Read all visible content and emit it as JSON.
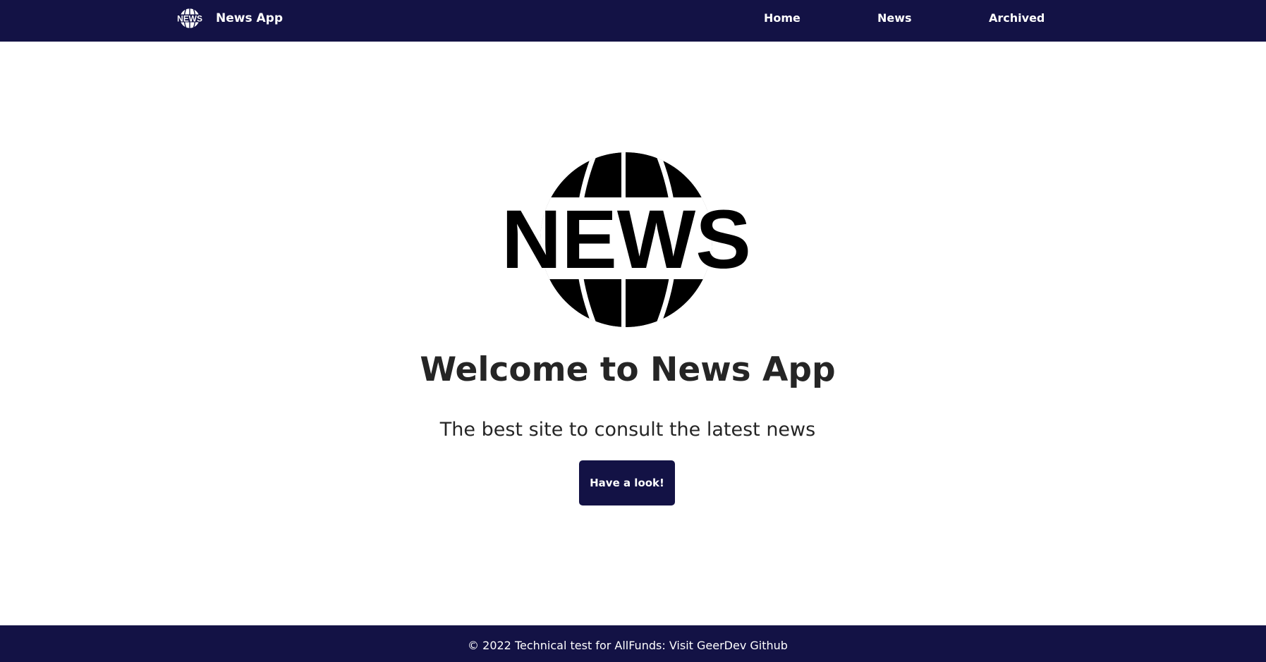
{
  "colors": {
    "nav_background": "#131245",
    "nav_text": "#ffffff",
    "heading_text": "#252525",
    "button_background": "#131245",
    "button_text": "#ffffff",
    "page_background": "#ffffff",
    "logo_color": "#000000"
  },
  "navbar": {
    "brand_icon": "news-globe-icon",
    "brand_icon_text": "NEWS",
    "brand_name": "News App",
    "links": [
      {
        "label": "Home"
      },
      {
        "label": "News"
      },
      {
        "label": "Archived"
      }
    ]
  },
  "hero": {
    "logo_icon": "news-globe-icon",
    "logo_text": "NEWS",
    "title": "Welcome to News App",
    "subtitle": "The best site to consult the latest news",
    "cta_label": "Have a look!"
  },
  "footer": {
    "text": "© 2022 Technical test for AllFunds:  ",
    "link_label": "Visit GeerDev Github"
  }
}
